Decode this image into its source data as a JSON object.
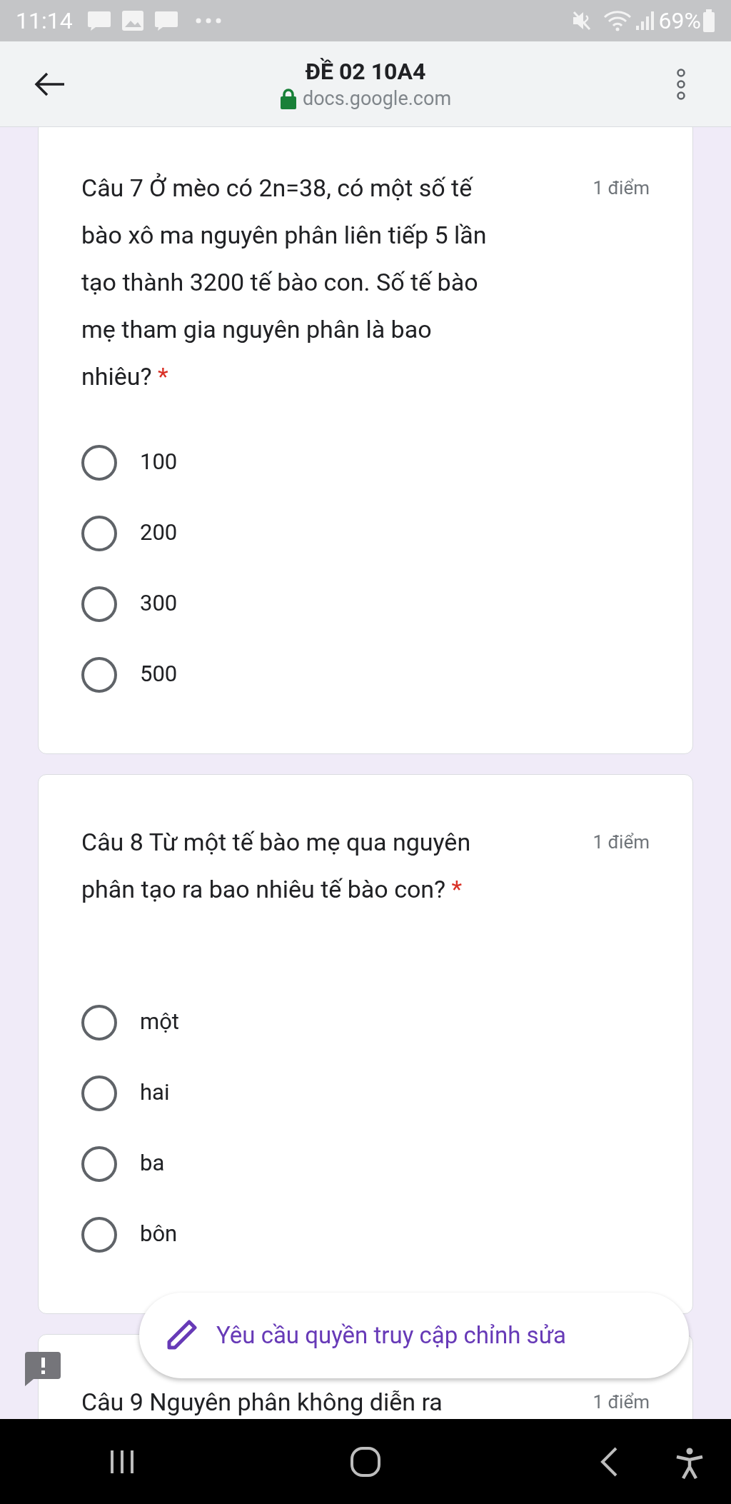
{
  "status_bar": {
    "time": "11:14",
    "battery": "69%"
  },
  "header": {
    "title": "ĐỀ 02 10A4",
    "url": "docs.google.com"
  },
  "questions": [
    {
      "text": "Câu 7 Ở mèo có 2n=38, có một số tế bào xô ma nguyên phân liên tiếp 5 lần tạo thành 3200 tế bào con. Số tế bào mẹ tham gia nguyên phân là bao nhiêu?",
      "required_mark": "*",
      "points": "1 điểm",
      "options": [
        {
          "label": "100",
          "selected": false
        },
        {
          "label": "200",
          "selected": false
        },
        {
          "label": "300",
          "selected": false
        },
        {
          "label": "500",
          "selected": false
        }
      ]
    },
    {
      "text": "Câu 8 Từ một tế bào mẹ qua nguyên phân tạo ra bao nhiêu tế bào con?",
      "required_mark": "*",
      "points": "1 điểm",
      "options": [
        {
          "label": "một",
          "selected": false
        },
        {
          "label": "hai",
          "selected": false
        },
        {
          "label": "ba",
          "selected": false
        },
        {
          "label": "bôn",
          "selected": false
        }
      ]
    },
    {
      "text": "Câu 9 Nguyên phân không diễn ra",
      "points": "1 điểm"
    }
  ],
  "edit_request_button": "Yêu cầu quyền truy cập chỉnh sửa"
}
